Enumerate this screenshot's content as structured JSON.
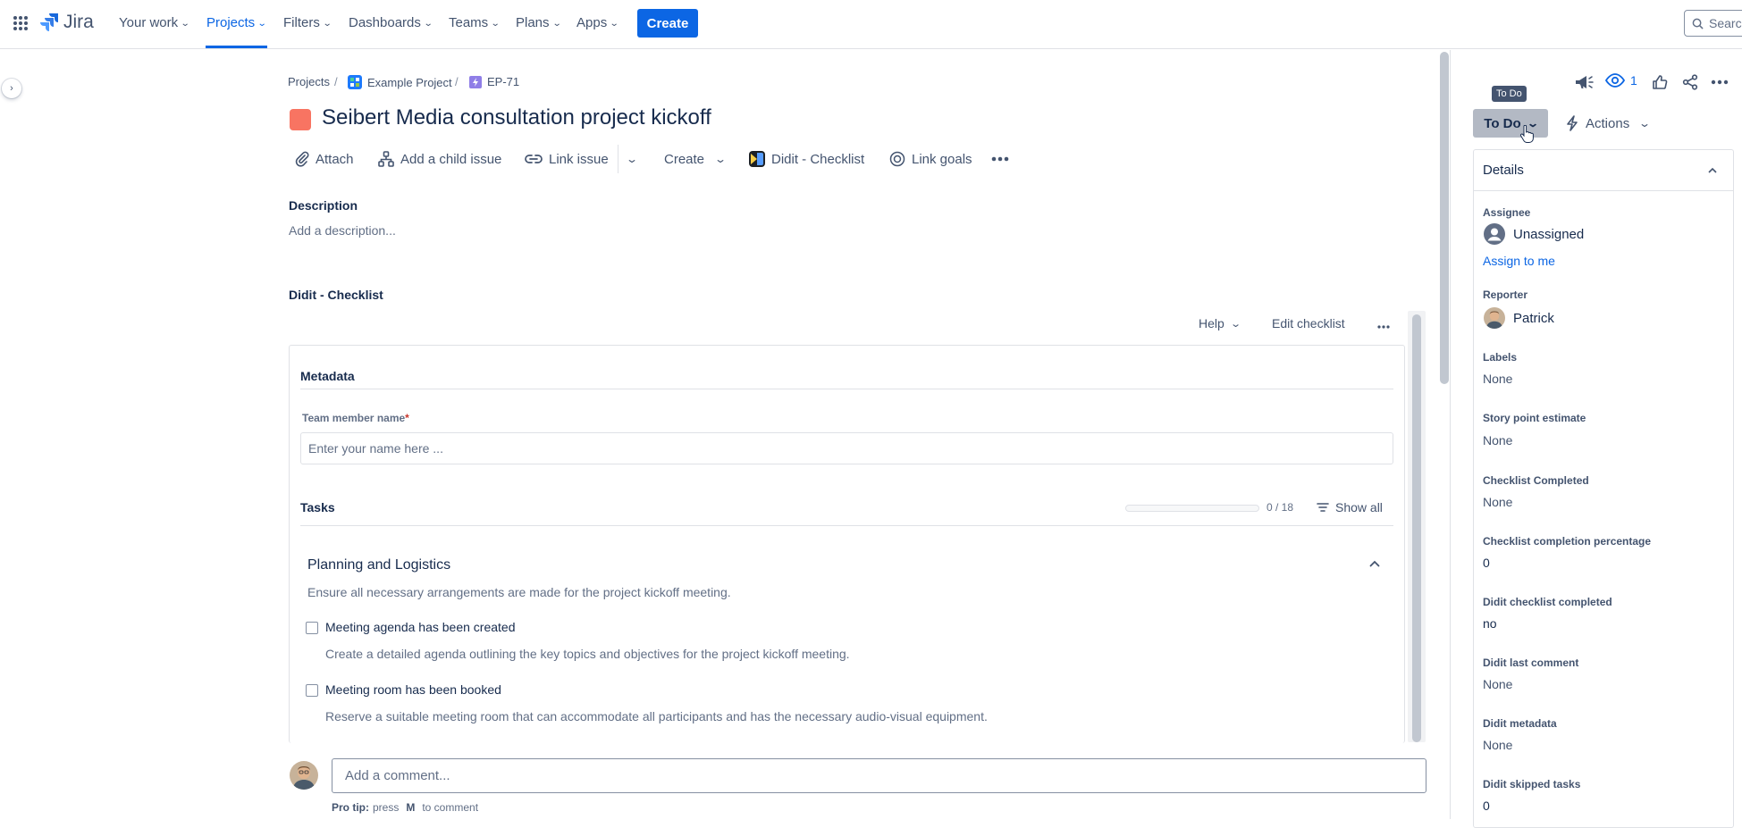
{
  "topnav": {
    "logo_text": "Jira",
    "items": [
      {
        "label": "Your work"
      },
      {
        "label": "Projects"
      },
      {
        "label": "Filters"
      },
      {
        "label": "Dashboards"
      },
      {
        "label": "Teams"
      },
      {
        "label": "Plans"
      },
      {
        "label": "Apps"
      }
    ],
    "create_label": "Create",
    "search_placeholder": "Search"
  },
  "breadcrumb": {
    "projects": "Projects",
    "project": "Example Project",
    "issue_key": "EP-71"
  },
  "issue": {
    "title": "Seibert Media consultation project kickoff"
  },
  "toolbar": {
    "attach": "Attach",
    "add_child": "Add a child issue",
    "link_issue": "Link issue",
    "create": "Create",
    "didit": "Didit - Checklist",
    "link_goals": "Link goals"
  },
  "description": {
    "heading": "Description",
    "placeholder": "Add a description..."
  },
  "checklist": {
    "heading": "Didit - Checklist",
    "help": "Help",
    "edit": "Edit checklist",
    "metadata_heading": "Metadata",
    "member_label": "Team member name",
    "required_mark": "*",
    "member_placeholder": "Enter your name here ...",
    "tasks_heading": "Tasks",
    "progress_text": "0 / 18",
    "progress_fraction": 0,
    "show_all": "Show all",
    "group_title": "Planning and Logistics",
    "group_desc": "Ensure all necessary arrangements are made for the project kickoff meeting.",
    "tasks": [
      {
        "title": "Meeting agenda has been created",
        "desc": "Create a detailed agenda outlining the key topics and objectives for the project kickoff meeting."
      },
      {
        "title": "Meeting room has been booked",
        "desc": "Reserve a suitable meeting room that can accommodate all participants and has the necessary audio-visual equipment."
      }
    ]
  },
  "comment": {
    "placeholder": "Add a comment...",
    "tip_bold": "Pro tip:",
    "tip_press": "press",
    "tip_key": "M",
    "tip_rest": "to comment"
  },
  "right": {
    "watch_count": "1",
    "tooltip": "To Do",
    "status": "To Do",
    "actions": "Actions",
    "details_heading": "Details",
    "assignee_label": "Assignee",
    "assignee_value": "Unassigned",
    "assign_to_me": "Assign to me",
    "reporter_label": "Reporter",
    "reporter_value": "Patrick",
    "fields": [
      {
        "label": "Labels",
        "value": "None"
      },
      {
        "label": "Story point estimate",
        "value": "None"
      },
      {
        "label": "Checklist Completed",
        "value": "None"
      },
      {
        "label": "Checklist completion percentage",
        "value": "0"
      },
      {
        "label": "Didit checklist completed",
        "value": "no"
      },
      {
        "label": "Didit last comment",
        "value": "None"
      },
      {
        "label": "Didit metadata",
        "value": "None"
      },
      {
        "label": "Didit skipped tasks",
        "value": "0"
      }
    ]
  },
  "colors": {
    "accent": "#0c66e4",
    "issue_type": "#f87462",
    "status_bg": "#b3b9c4"
  }
}
